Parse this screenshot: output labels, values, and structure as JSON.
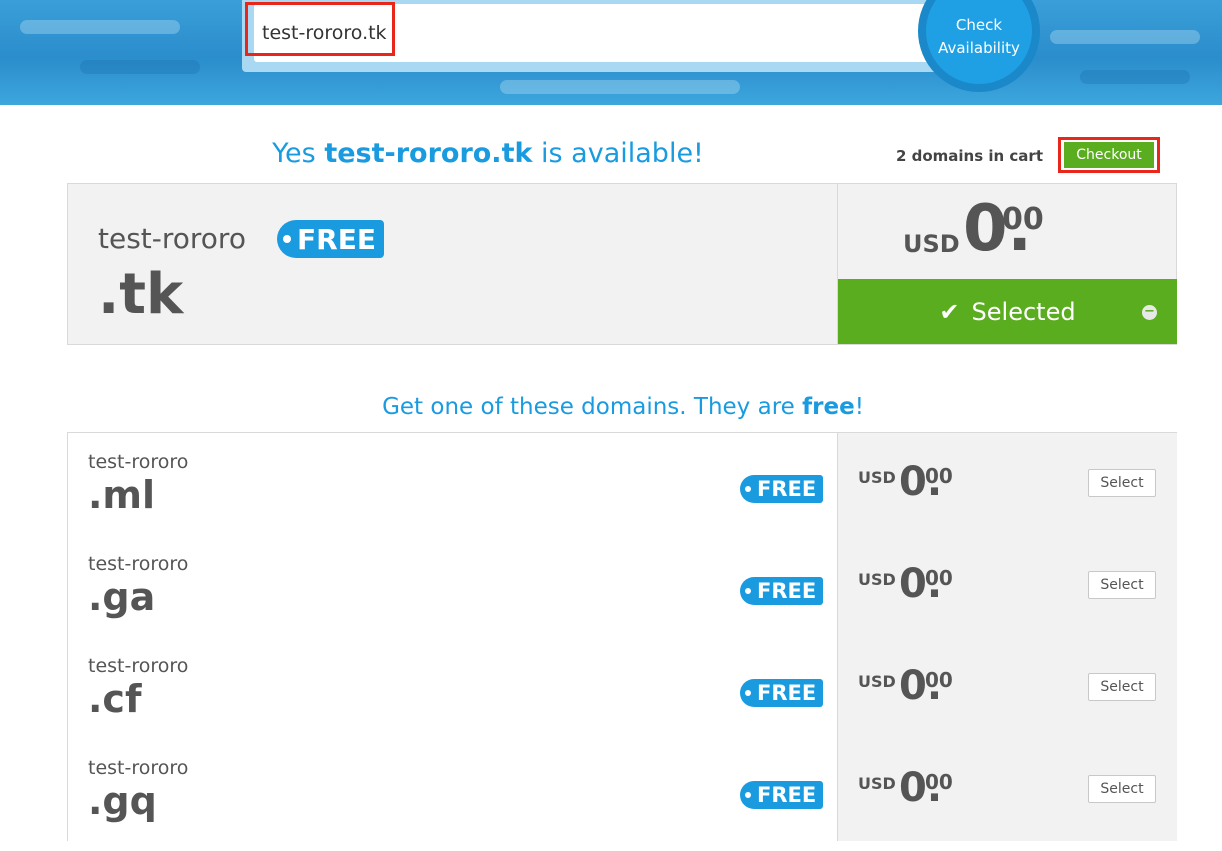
{
  "search": {
    "value": "test-rororo.tk",
    "check_button_line1": "Check",
    "check_button_line2": "Availability"
  },
  "result": {
    "title_prefix": "Yes",
    "title_domain": "test-rororo.tk",
    "title_suffix": "is available!",
    "cart_count": "2 domains in cart",
    "checkout_label": "Checkout",
    "main": {
      "name": "test-rororo",
      "tld": ".tk",
      "badge": "FREE",
      "currency": "USD",
      "price_int": "0.",
      "price_dec": "00",
      "selected_label": "Selected"
    }
  },
  "suggestions": {
    "title_prefix": "Get one of these domains. They are",
    "title_bold": "free",
    "title_suffix": "!",
    "items": [
      {
        "name": "test-rororo",
        "tld": ".ml",
        "badge": "FREE",
        "currency": "USD",
        "price_int": "0.",
        "price_dec": "00",
        "button": "Select"
      },
      {
        "name": "test-rororo",
        "tld": ".ga",
        "badge": "FREE",
        "currency": "USD",
        "price_int": "0.",
        "price_dec": "00",
        "button": "Select"
      },
      {
        "name": "test-rororo",
        "tld": ".cf",
        "badge": "FREE",
        "currency": "USD",
        "price_int": "0.",
        "price_dec": "00",
        "button": "Select"
      },
      {
        "name": "test-rororo",
        "tld": ".gq",
        "badge": "FREE",
        "currency": "USD",
        "price_int": "0.",
        "price_dec": "00",
        "button": "Select"
      }
    ]
  },
  "colors": {
    "accent_blue": "#1a9be0",
    "green": "#5aad1f",
    "highlight_red": "#e8271a"
  },
  "icons": {
    "selected": "check-icon",
    "deselect": "minus-circle-icon"
  }
}
